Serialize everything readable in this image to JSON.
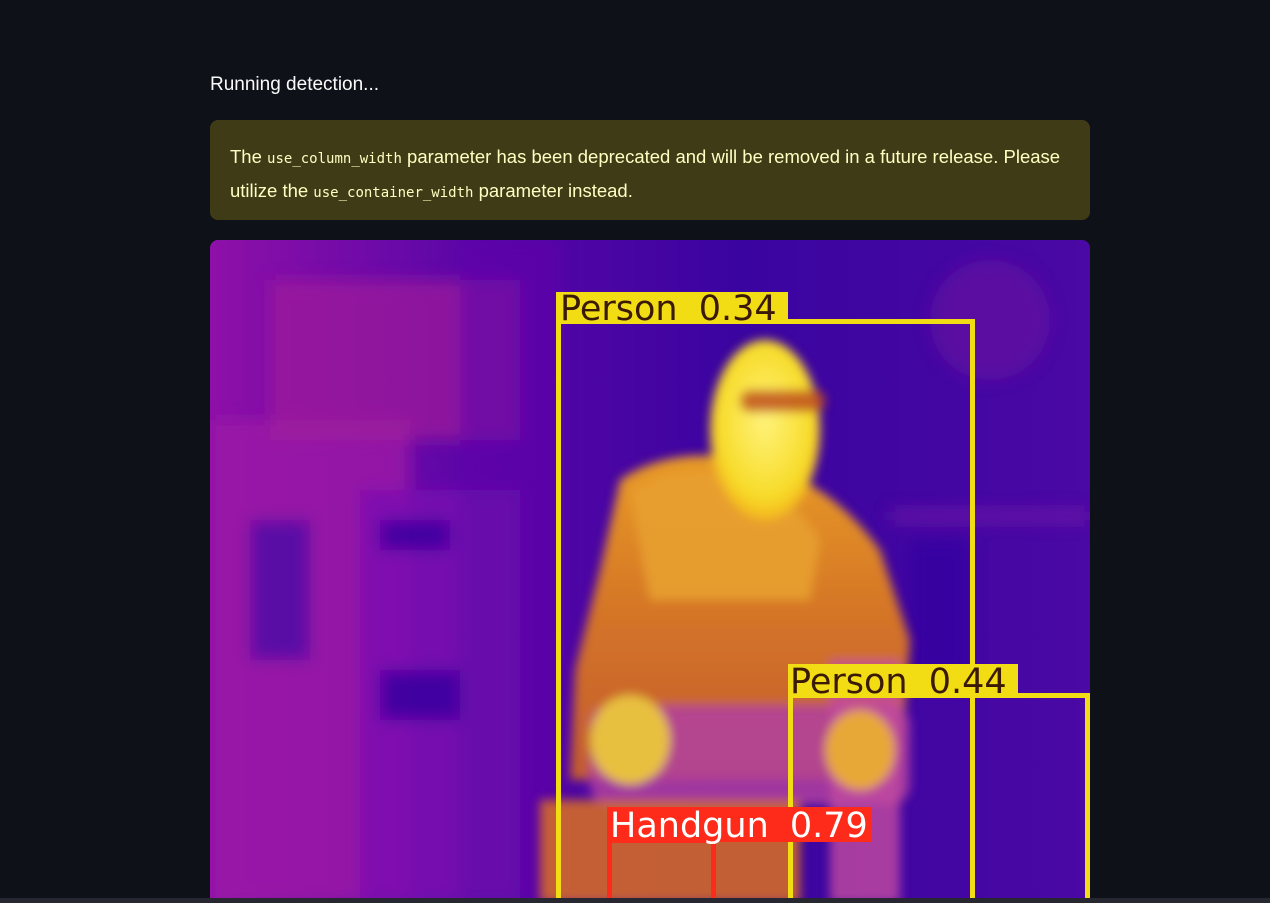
{
  "status": {
    "text": "Running detection..."
  },
  "warning": {
    "prefix": "The ",
    "param_old": "use_column_width",
    "middle": " parameter has been deprecated and will be removed in a future release. Please utilize the ",
    "param_new": "use_container_width",
    "suffix": " parameter instead."
  },
  "detection_image": {
    "palette": "thermal-inferno",
    "detections": [
      {
        "label": "Person",
        "score": "0.34",
        "color": "#f2dc14"
      },
      {
        "label": "Person",
        "score": "0.44",
        "color": "#f2dc14"
      },
      {
        "label": "Handgun",
        "score": "0.79",
        "color": "#ff2b1a"
      }
    ]
  },
  "colors": {
    "background": "#0e1117",
    "warning_bg": "#3e3b16",
    "warning_text": "#ffffc2"
  }
}
